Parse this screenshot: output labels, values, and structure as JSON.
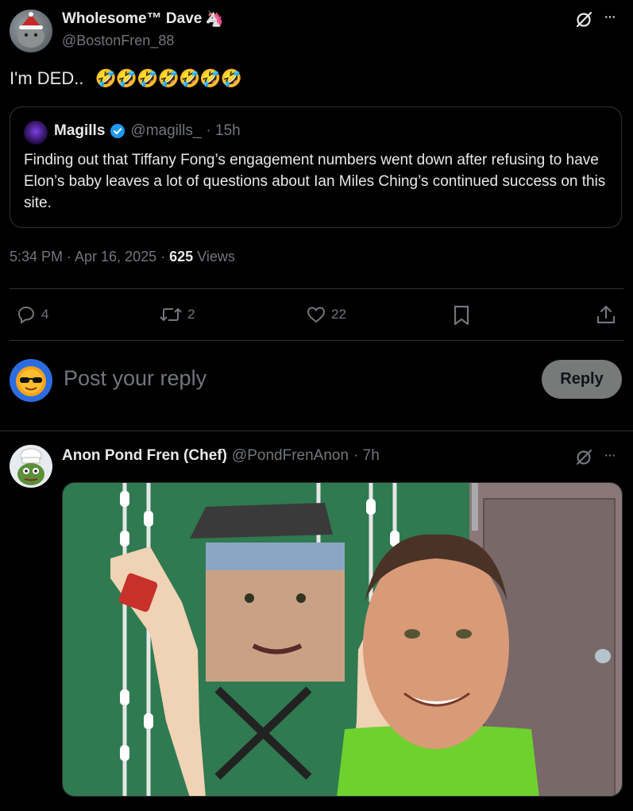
{
  "tweet": {
    "display_name": "Wholesome™ Dave",
    "name_emoji": "🦄",
    "handle": "@BostonFren_88",
    "text": "I'm DED..",
    "emojis": "🤣🤣🤣🤣🤣🤣🤣",
    "more_label": "···",
    "timestamp": "5:34 PM · Apr 16, 2025 · ",
    "views_count": "625",
    "views_label": "Views"
  },
  "quote": {
    "display_name": "Magills",
    "handle": "@magills_",
    "time": "· 15h",
    "text": "Finding out that Tiffany Fong’s engagement numbers went down after refusing to have Elon’s baby leaves a lot of questions about Ian Miles Ching’s continued success on this site."
  },
  "actions": {
    "replies": "4",
    "reposts": "2",
    "likes": "22"
  },
  "reply_box": {
    "placeholder": "Post your reply",
    "button_label": "Reply"
  },
  "reply": {
    "display_name": "Anon Pond Fren (Chef)",
    "handle": "@PondFrenAnon",
    "time": "· 7h",
    "more_label": "···"
  },
  "colors": {
    "background": "#000000",
    "text": "#e7e9ea",
    "muted": "#71767b",
    "border": "#2f3336",
    "verified": "#1d9bf0"
  }
}
